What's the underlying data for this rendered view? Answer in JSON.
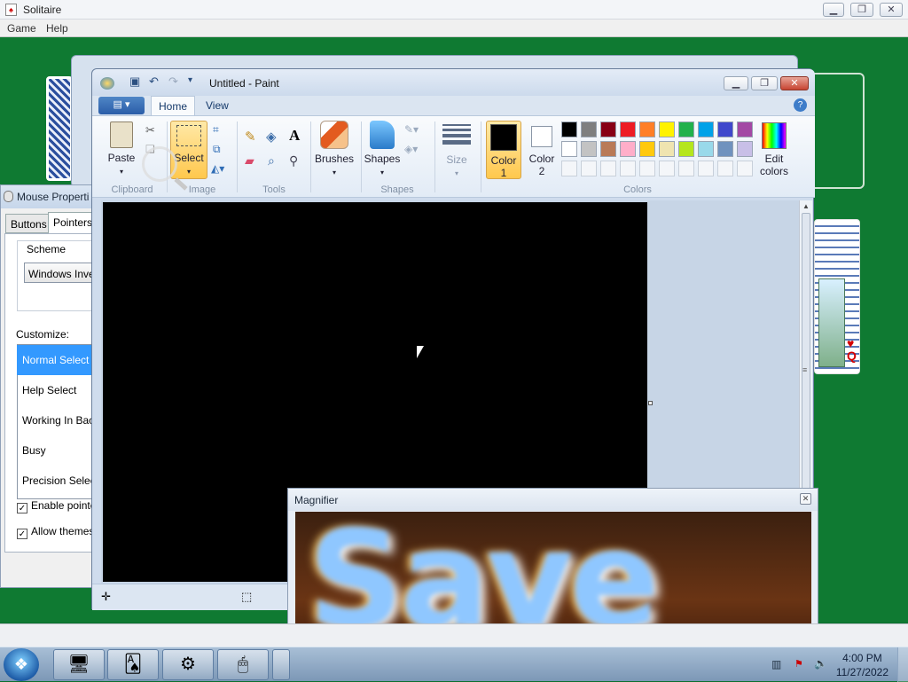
{
  "solitaire": {
    "title": "Solitaire",
    "menu": [
      "Game",
      "Help"
    ]
  },
  "mouse_properties": {
    "title": "Mouse Properti",
    "tabs": [
      "Buttons",
      "Pointers"
    ],
    "scheme_label": "Scheme",
    "scheme_value": "Windows Inver",
    "customize_label": "Customize:",
    "pointers": [
      "Normal Select",
      "Help Select",
      "Working In Back",
      "Busy",
      "Precision Select"
    ],
    "checkboxes": [
      {
        "label": "Enable pointer",
        "checked": true
      },
      {
        "label": "Allow themes t",
        "checked": true
      }
    ]
  },
  "paint": {
    "title": "Untitled - Paint",
    "tabs": [
      "Home",
      "View"
    ],
    "groups": {
      "clipboard": "Clipboard",
      "image": "Image",
      "tools": "Tools",
      "shapes": "Shapes",
      "colors": "Colors"
    },
    "buttons": {
      "paste": "Paste",
      "select": "Select",
      "brushes": "Brushes",
      "shapes": "Shapes",
      "size": "Size",
      "color1_a": "Color",
      "color1_b": "1",
      "color2_a": "Color",
      "color2_b": "2",
      "edit_colors_a": "Edit",
      "edit_colors_b": "colors"
    },
    "color1": "#000000",
    "color2": "#ffffff",
    "palette_row1": [
      "#000000",
      "#7f7f7f",
      "#880015",
      "#ed1c24",
      "#ff7f27",
      "#fff200",
      "#22b14c",
      "#00a2e8",
      "#3f48cc",
      "#a349a4"
    ],
    "palette_row2": [
      "#ffffff",
      "#c3c3c3",
      "#b97a57",
      "#ffaec9",
      "#ffc90e",
      "#efe4b0",
      "#b5e61d",
      "#99d9ea",
      "#7092be",
      "#c8bfe7"
    ]
  },
  "magnifier": {
    "title": "Magnifier",
    "magnified_text": "Save"
  },
  "taskbar": {
    "time": "4:00 PM",
    "date": "11/27/2022"
  }
}
